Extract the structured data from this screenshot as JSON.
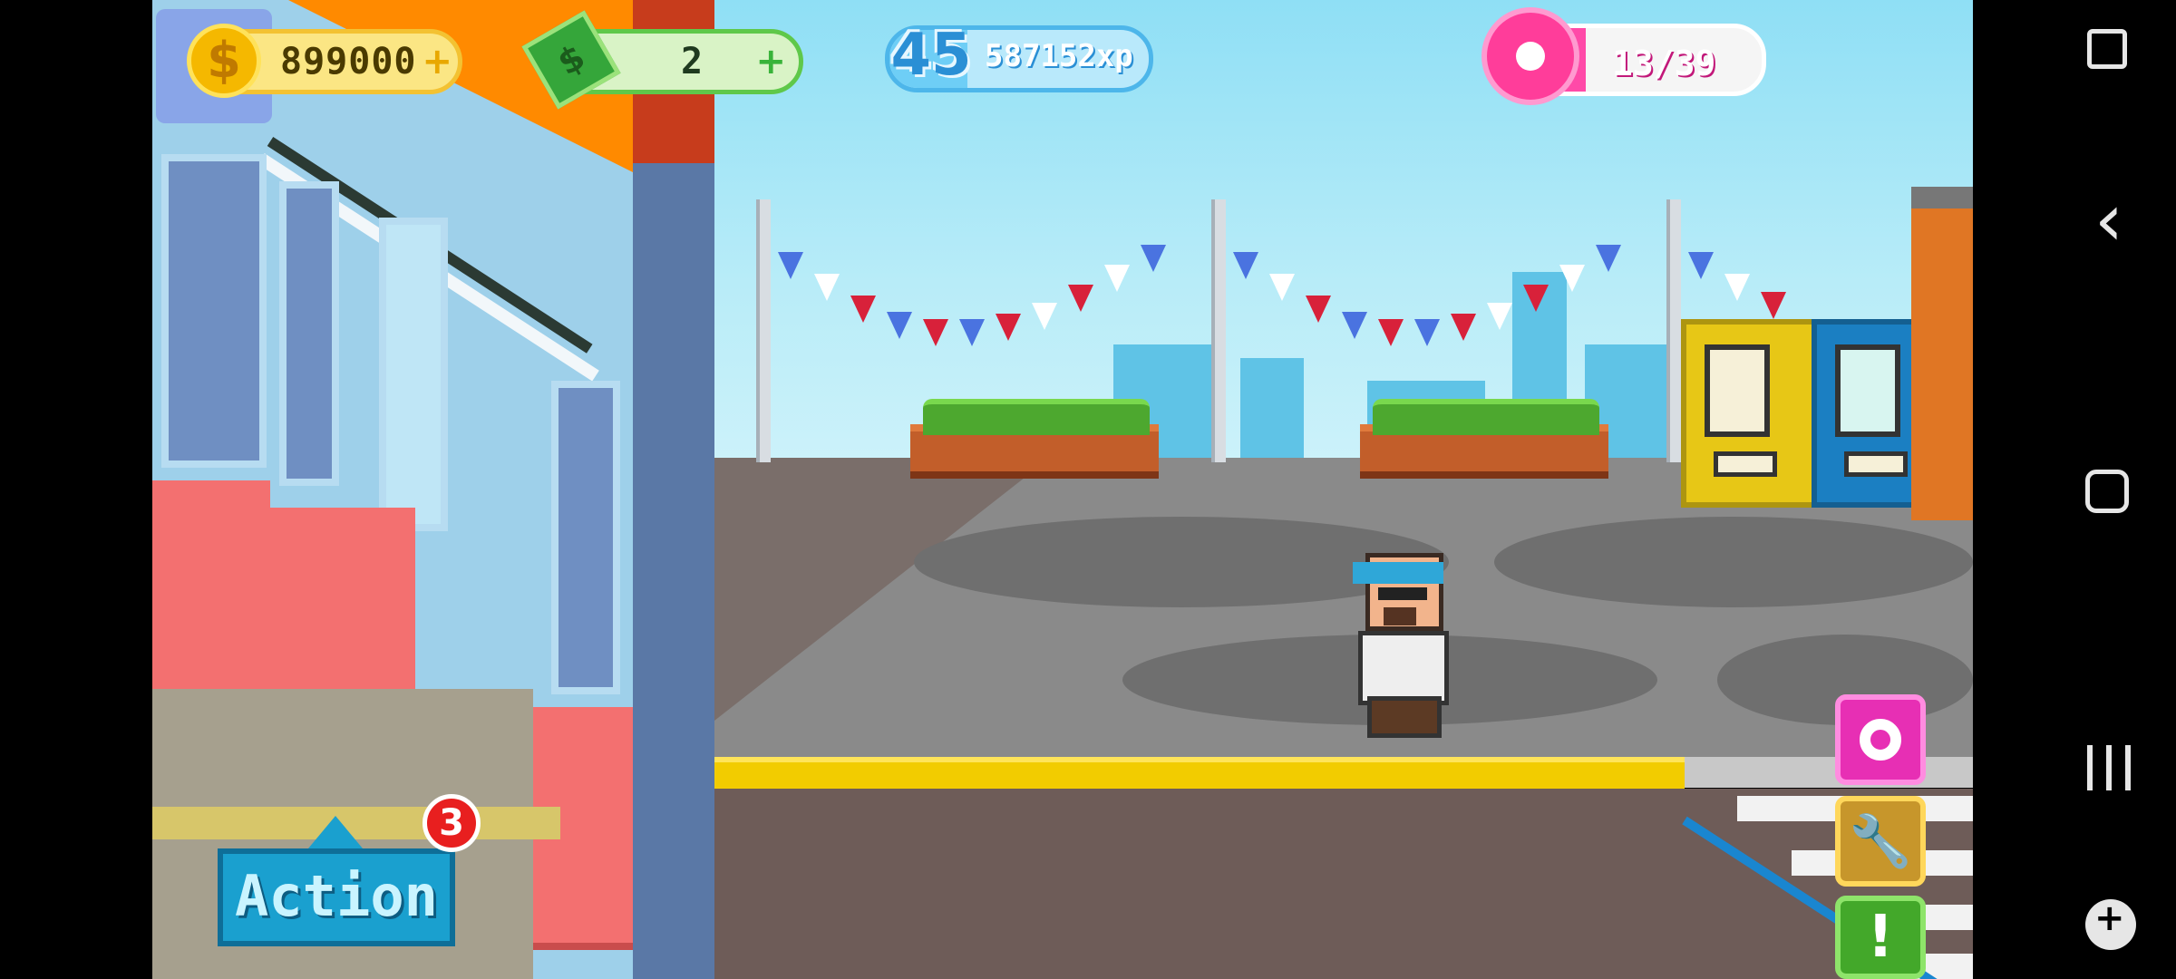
{
  "hud": {
    "coins": "899000",
    "coins_plus": "+",
    "coins_icon": "$",
    "cash": "2",
    "cash_plus": "+",
    "level": "45",
    "xp": "587152xp",
    "xp_progress": 0.3,
    "donuts": "13/39",
    "donut_progress": 0.34
  },
  "action": {
    "label": "Action",
    "badge_count": "3"
  },
  "tools": {
    "alert_label": "!",
    "wrench_label": "🔧"
  },
  "system_nav": {
    "back": "‹"
  },
  "colors": {
    "sky": "#8fdff5",
    "curb": "#f2cc00",
    "action": "#1aa0cf",
    "donut": "#ff3d9a",
    "cash": "#35a63a",
    "coin": "#f5b800"
  },
  "icons": [
    "coin-icon",
    "cash-icon",
    "level-star-icon",
    "donut-icon",
    "wrench-icon",
    "alert-icon",
    "back-icon",
    "home-icon",
    "recents-icon",
    "gamepad-icon",
    "screenshot-icon"
  ]
}
